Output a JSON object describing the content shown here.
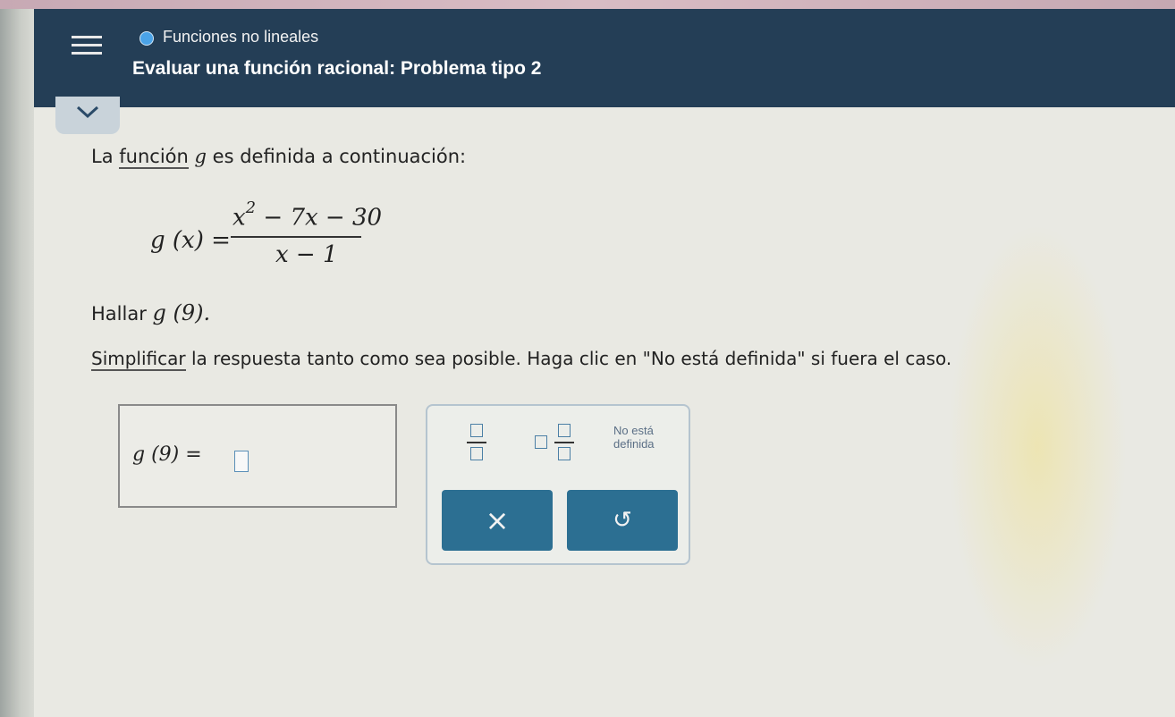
{
  "header": {
    "topic": "Funciones no lineales",
    "title": "Evaluar una función racional: Problema tipo 2"
  },
  "problem": {
    "intro_word": "La",
    "intro_link": "función",
    "intro_var": "g",
    "intro_rest": "es definida a continuación:",
    "function_lhs": "g (x) =",
    "numerator_x": "x",
    "numerator_exp": "2",
    "numerator_rest": "− 7x − 30",
    "denominator": "x − 1",
    "find_prefix": "Hallar",
    "find_expr": "g (9).",
    "simplify_link": "Simplificar",
    "instructions": "la respuesta tanto como sea posible. Haga clic en \"No está definida\" si fuera el caso."
  },
  "answer": {
    "label": "g (9)  =",
    "value": ""
  },
  "keypad": {
    "undefined_line1": "No está",
    "undefined_line2": "definida",
    "clear_icon": "×",
    "undo_icon": "↺"
  },
  "colors": {
    "header_bg": "#243e56",
    "button_bg": "#2c6f92",
    "accent": "#4aa3e8"
  }
}
